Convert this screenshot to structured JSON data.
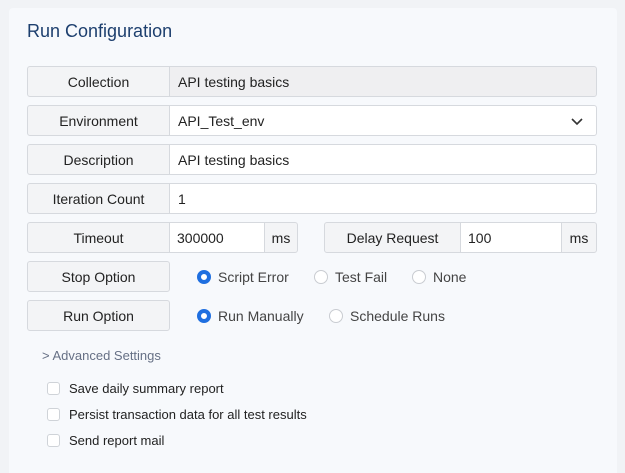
{
  "title": "Run Configuration",
  "collection": {
    "label": "Collection",
    "value": "API testing basics"
  },
  "environment": {
    "label": "Environment",
    "value": "API_Test_env",
    "icon": "chevron-down-icon"
  },
  "description": {
    "label": "Description",
    "value": "API testing basics"
  },
  "iteration": {
    "label": "Iteration Count",
    "value": "1"
  },
  "timeout": {
    "label": "Timeout",
    "value": "300000",
    "unit": "ms"
  },
  "delay": {
    "label": "Delay Request",
    "value": "100",
    "unit": "ms"
  },
  "stop_option": {
    "label": "Stop Option",
    "options": [
      "Script Error",
      "Test Fail",
      "None"
    ],
    "selected": "Script Error"
  },
  "run_option": {
    "label": "Run Option",
    "options": [
      "Run Manually",
      "Schedule Runs"
    ],
    "selected": "Run Manually"
  },
  "advanced": {
    "label": "> Advanced Settings"
  },
  "checkboxes": [
    {
      "label": "Save daily summary report",
      "checked": false
    },
    {
      "label": "Persist transaction data for all test results",
      "checked": false
    },
    {
      "label": "Send report mail",
      "checked": false
    }
  ],
  "colors": {
    "accent": "#1f6fe0",
    "title": "#1d3f6e"
  }
}
